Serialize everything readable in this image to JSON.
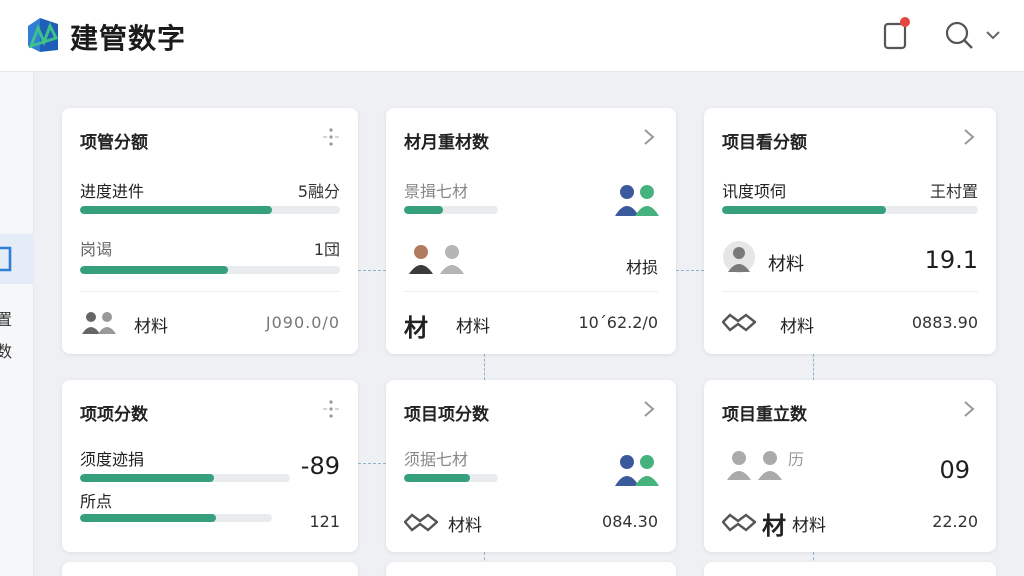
{
  "header": {
    "title": "建管数字"
  },
  "sidebar": {
    "texts": [
      "置",
      "数"
    ]
  },
  "cards": [
    {
      "title": "项管分额",
      "row1": {
        "label": "进度进件",
        "value": "5融分",
        "progress": 0.74
      },
      "row2": {
        "label": "岗谒",
        "value": "1団",
        "progress": 0.57
      },
      "footer": {
        "label": "材料",
        "value": "J090.0/0"
      }
    },
    {
      "title": "材月重材数",
      "row1": {
        "label": "景揖七材",
        "progress": 0.42
      },
      "mid": {
        "label": "材损"
      },
      "footer": {
        "char": "材",
        "label": "材料",
        "value": "10΄62.2/0"
      }
    },
    {
      "title": "项目看分额",
      "row1": {
        "label": "讯度项伺",
        "value": "王村置",
        "progress": 0.64
      },
      "mid": {
        "label": "材料",
        "value": "19.1"
      },
      "footer": {
        "label": "材料",
        "value": "0883.90"
      }
    },
    {
      "title": "项项分数",
      "row1": {
        "label": "须度迹捐",
        "value": "-89",
        "progress": 0.64
      },
      "row2": {
        "label": "所点",
        "value": "121",
        "progress": 0.71
      },
      "footer": {}
    },
    {
      "title": "项目项分数",
      "row1": {
        "label": "须据七材",
        "progress": 0.7
      },
      "footer": {
        "label": "材料",
        "value": "084.30"
      }
    },
    {
      "title": "项目重立数",
      "mid": {
        "label": "历",
        "value": "09"
      },
      "footer": {
        "char": "材",
        "label": "材料",
        "value": "22.20"
      }
    }
  ],
  "colors": {
    "accent": "#36a07c",
    "notification": "#e4473e",
    "avatar_blue": "#3a5a9c",
    "avatar_green": "#46b37e"
  }
}
